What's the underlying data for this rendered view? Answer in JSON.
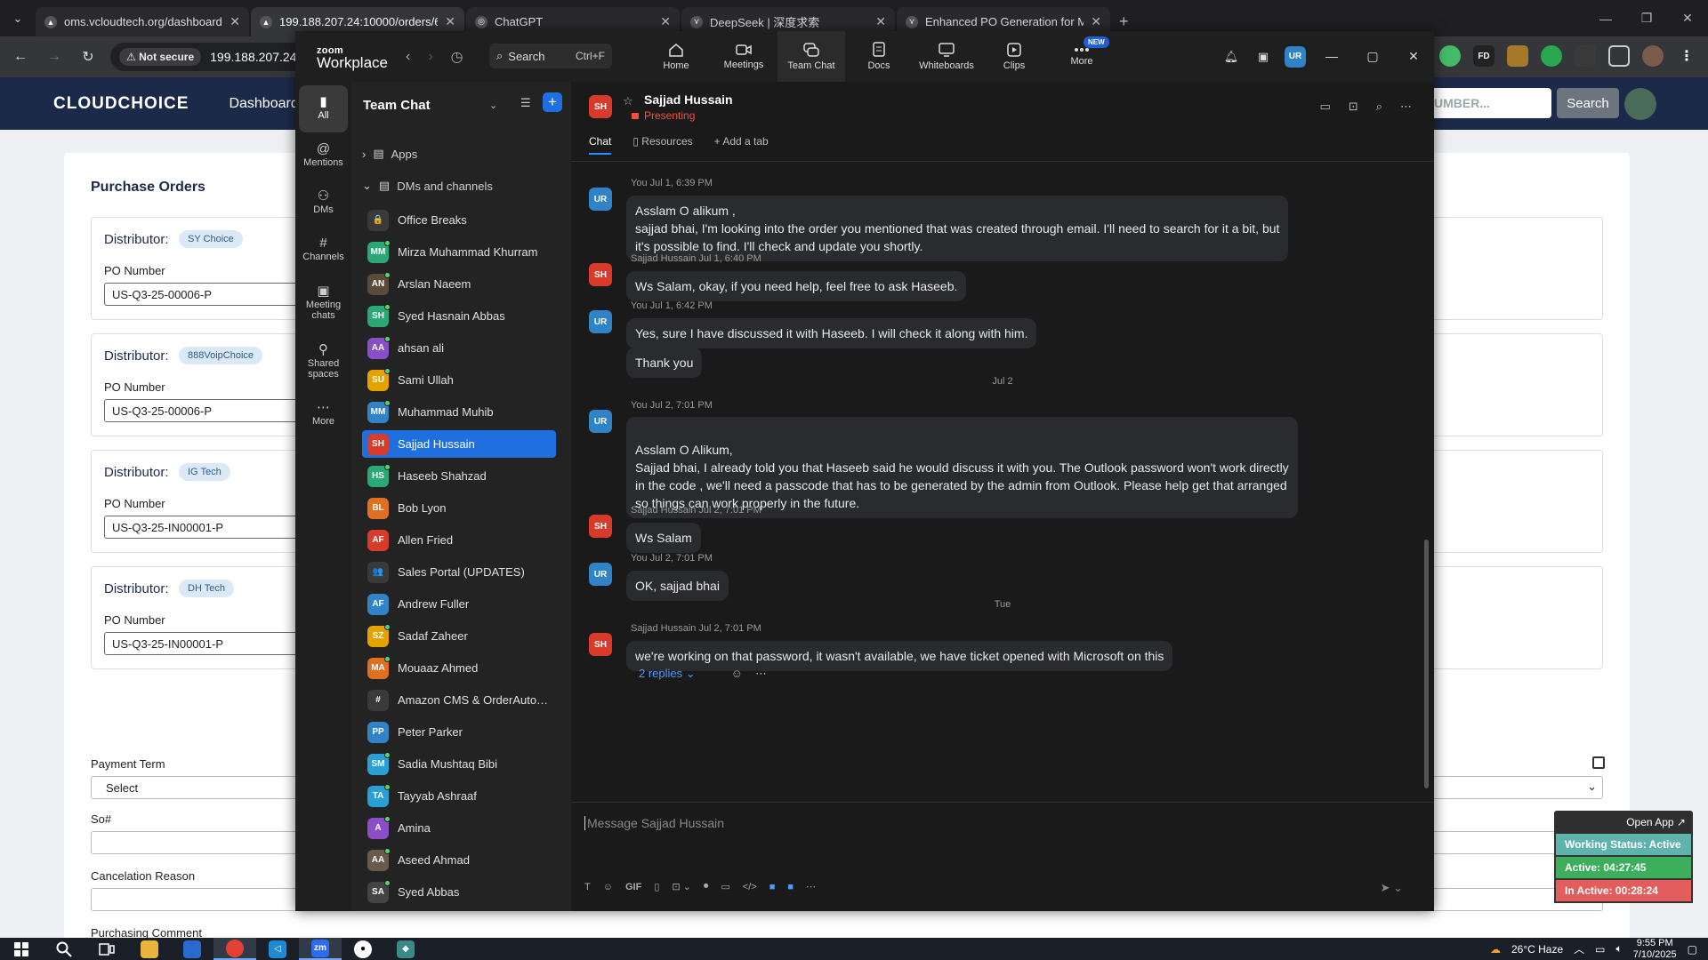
{
  "browser": {
    "tabs": [
      {
        "title": "oms.vcloudtech.org/dashboard",
        "fav": "▲",
        "active": false
      },
      {
        "title": "199.188.207.24:10000/orders/6…",
        "fav": "▲",
        "active": true
      },
      {
        "title": "ChatGPT",
        "fav": "◎",
        "active": false
      },
      {
        "title": "DeepSeek | 深度求索",
        "fav": "⋎",
        "active": false
      },
      {
        "title": "Enhanced PO Generation for M…",
        "fav": "⋎",
        "active": false
      }
    ],
    "not_secure": "Not secure",
    "url": "199.188.207.24:10"
  },
  "site": {
    "logo": "CLOUDCHOICE",
    "nav_dashboard": "Dashboard",
    "search_placeholder": "UMBER...",
    "search_button": "Search",
    "page_title": "Purchase Orders",
    "distributor_label": "Distributor:",
    "po_number_label": "PO Number",
    "distributors": [
      {
        "badge": "SY Choice",
        "po": "US-Q3-25-00006-P"
      },
      {
        "badge": "888VoipChoice",
        "po": "US-Q3-25-00006-P"
      },
      {
        "badge": "IG Tech",
        "po": "US-Q3-25-IN00001-P"
      },
      {
        "badge": "DH Tech",
        "po": "US-Q3-25-IN00001-P"
      }
    ],
    "payment_term_label": "Payment Term",
    "payment_term_value": "Select",
    "so_label": "So#",
    "cancel_label": "Cancelation Reason",
    "comment_label": "Purchasing Comment"
  },
  "widget": {
    "open_app": "Open App ↗",
    "working_status": "Working Status: Active",
    "active": "Active: 04:27:45",
    "inactive": "In Active: 00:28:24"
  },
  "taskbar": {
    "weather": "26°C  Haze",
    "time": "9:55 PM",
    "date": "7/10/2025"
  },
  "zoom": {
    "logo_top": "zoom",
    "logo_bottom": "Workplace",
    "search": "Search",
    "search_kbd": "Ctrl+F",
    "nav": [
      {
        "label": "Home",
        "icon": "home-icon"
      },
      {
        "label": "Meetings",
        "icon": "camera-icon"
      },
      {
        "label": "Team Chat",
        "icon": "chat-icon"
      },
      {
        "label": "Docs",
        "icon": "doc-icon"
      },
      {
        "label": "Whiteboards",
        "icon": "whiteboard-icon"
      },
      {
        "label": "Clips",
        "icon": "clips-icon"
      },
      {
        "label": "More",
        "icon": "more-icon"
      }
    ],
    "new_badge": "NEW",
    "avatar": "UR",
    "rail": [
      {
        "label": "All"
      },
      {
        "label": "Mentions"
      },
      {
        "label": "DMs"
      },
      {
        "label": "Channels"
      },
      {
        "label": "Meeting chats"
      },
      {
        "label": "Shared spaces"
      },
      {
        "label": "More"
      }
    ],
    "sidebar": {
      "title": "Team Chat",
      "apps": "Apps",
      "dms": "DMs and channels",
      "items": [
        {
          "name": "Office Breaks",
          "init": "🔒",
          "color": "#3a3a3a",
          "online": false
        },
        {
          "name": "Mirza Muhammad Khurram",
          "init": "MM",
          "color": "#2aa876",
          "online": true
        },
        {
          "name": "Arslan Naeem",
          "init": "AN",
          "color": "#5b4a3a",
          "online": true
        },
        {
          "name": "Syed Hasnain Abbas",
          "init": "SH",
          "color": "#2aa876",
          "online": true
        },
        {
          "name": "ahsan ali",
          "init": "AA",
          "color": "#8a4fc7",
          "online": true
        },
        {
          "name": "Sami Ullah",
          "init": "SU",
          "color": "#e5a100",
          "online": true
        },
        {
          "name": "Muhammad Muhib",
          "init": "MM",
          "color": "#2f83c6",
          "online": true
        },
        {
          "name": "Sajjad Hussain",
          "init": "SH",
          "color": "#d93b2b",
          "online": false
        },
        {
          "name": "Haseeb Shahzad",
          "init": "HS",
          "color": "#2aa876",
          "online": true
        },
        {
          "name": "Bob Lyon",
          "init": "BL",
          "color": "#e0701f",
          "online": false
        },
        {
          "name": "Allen Fried",
          "init": "AF",
          "color": "#d93b2b",
          "online": false
        },
        {
          "name": "Sales Portal (UPDATES)",
          "init": "👥",
          "color": "#3a3a3a",
          "online": false
        },
        {
          "name": "Andrew Fuller",
          "init": "AF",
          "color": "#2f83c6",
          "online": false
        },
        {
          "name": "Sadaf Zaheer",
          "init": "SZ",
          "color": "#e5a100",
          "online": true
        },
        {
          "name": "Mouaaz Ahmed",
          "init": "MA",
          "color": "#e0701f",
          "online": true
        },
        {
          "name": "Amazon CMS & OrderAuto…",
          "init": "#",
          "color": "#3a3a3a",
          "online": false
        },
        {
          "name": "Peter Parker",
          "init": "PP",
          "color": "#2f83c6",
          "online": false
        },
        {
          "name": "Sadia Mushtaq Bibi",
          "init": "SM",
          "color": "#2a9fd6",
          "online": true
        },
        {
          "name": "Tayyab Ashraaf",
          "init": "TA",
          "color": "#2a9fd6",
          "online": true
        },
        {
          "name": "Amina",
          "init": "A",
          "color": "#8a4fc7",
          "online": true
        },
        {
          "name": "Aseed Ahmad",
          "init": "AA",
          "color": "#6a5a4a",
          "online": true
        },
        {
          "name": "Syed Abbas",
          "init": "SA",
          "color": "#444",
          "online": true
        }
      ]
    },
    "chat": {
      "name": "Sajjad Hussain",
      "initials": "SH",
      "status": "Presenting",
      "tabs": {
        "chat": "Chat",
        "resources": "Resources",
        "add": "Add a tab"
      },
      "messages": [
        {
          "who": "UR",
          "meta": "You Jul 1, 6:39 PM",
          "lines": [
            "Asslam O alikum ,",
            "sajjad bhai, I'm looking into the order you mentioned that was created through email. I'll need to search for it a bit, but",
            "it's possible to find. I'll check and update you shortly."
          ]
        },
        {
          "who": "SH",
          "meta": "Sajjad Hussain Jul 1, 6:40 PM",
          "lines": [
            "Ws Salam, okay, if you need help, feel free to ask Haseeb."
          ]
        },
        {
          "who": "UR",
          "meta": "You Jul 1, 6:42 PM",
          "lines": [
            "Yes, sure  I have discussed it with Haseeb. I will check it along with him."
          ]
        },
        {
          "who": "",
          "meta": "",
          "lines": [
            "Thank you"
          ]
        },
        {
          "who": "UR",
          "meta": "You Jul 2, 7:01 PM",
          "lines": [
            "",
            "Asslam O Alikum,",
            "Sajjad bhai, I already told you that Haseeb said he would discuss it with you. The Outlook password won't work directly",
            "in the code , we'll need a passcode that has to be generated by the admin from Outlook. Please help get that arranged",
            "so things can work properly in the future."
          ]
        },
        {
          "who": "SH",
          "meta": "Sajjad Hussain Jul 2, 7:01 PM",
          "lines": [
            "Ws Salam"
          ]
        },
        {
          "who": "UR",
          "meta": "You Jul 2, 7:01 PM",
          "lines": [
            "OK, sajjad bhai"
          ]
        },
        {
          "who": "SH",
          "meta": "Sajjad Hussain Jul 2, 7:01 PM",
          "lines": [
            "we're working on that password, it wasn't available, we have ticket opened with Microsoft on this"
          ]
        }
      ],
      "day_jul2": "Jul 2",
      "day_tue": "Tue",
      "replies": "2 replies ⌄",
      "composer_placeholder": "Message Sajjad Hussain"
    }
  }
}
